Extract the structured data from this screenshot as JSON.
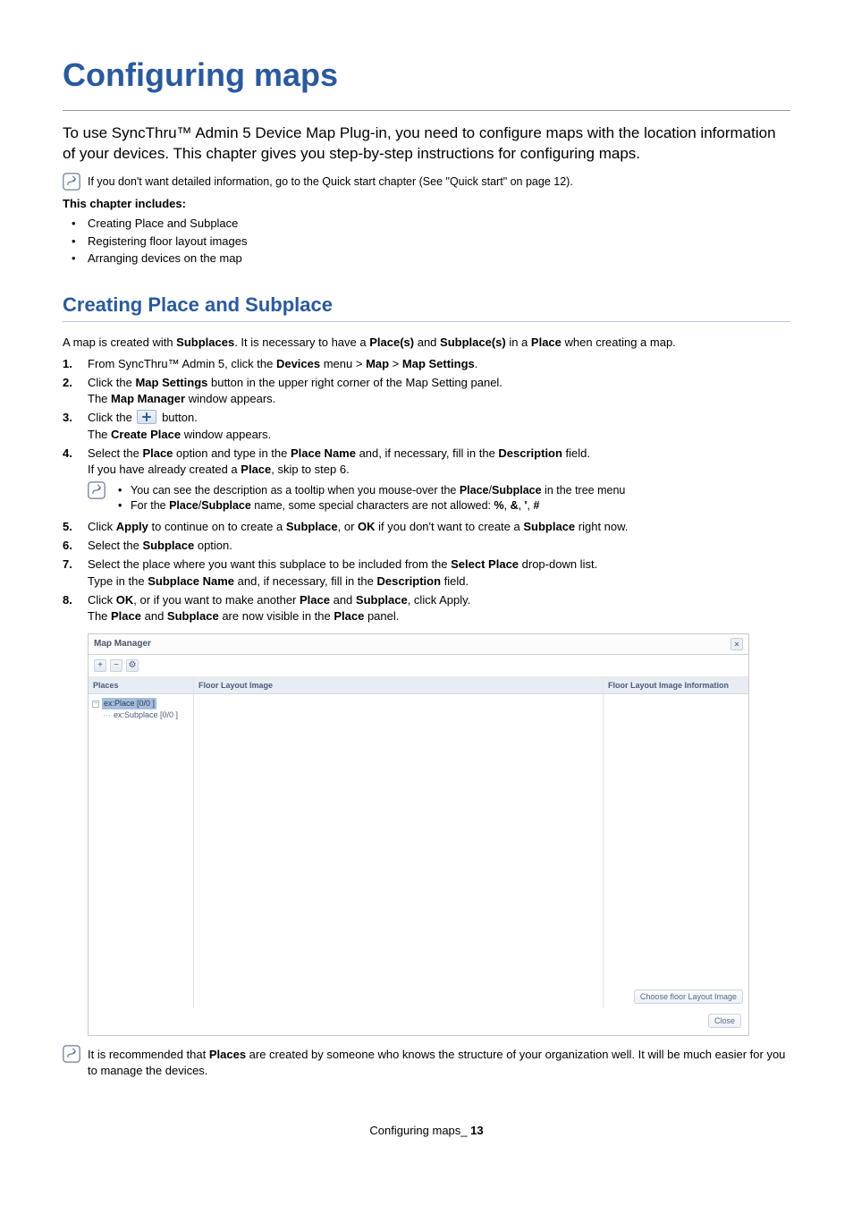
{
  "title": "Configuring maps",
  "intro": "To use SyncThru™ Admin 5 Device Map Plug-in, you need to configure maps with the location information of your devices. This chapter gives you step-by-step instructions for configuring maps.",
  "note_quickstart": "If you don't want detailed information, go to the Quick start chapter (See \"Quick start\" on page 12).",
  "includes_heading": "This chapter includes:",
  "includes": [
    "Creating Place and Subplace",
    "Registering floor layout images",
    "Arranging devices on the map"
  ],
  "section_heading": "Creating Place and Subplace",
  "section_intro_pre": "A map is created with ",
  "section_intro_b1": "Subplaces",
  "section_intro_mid1": ". It is necessary to have a ",
  "section_intro_b2": "Place(s)",
  "section_intro_mid2": " and ",
  "section_intro_b3": "Subplace(s)",
  "section_intro_mid3": " in a ",
  "section_intro_b4": "Place",
  "section_intro_post": " when creating a map.",
  "steps": {
    "s1_a": "From SyncThru™ Admin 5, click the ",
    "s1_b1": "Devices",
    "s1_b": " menu > ",
    "s1_b2": "Map",
    "s1_c": " > ",
    "s1_b3": "Map Settings",
    "s1_d": ".",
    "s2_a": "Click the ",
    "s2_b1": "Map Settings",
    "s2_b": " button in the upper right corner of the Map Setting panel.",
    "s2_sub_a": "The ",
    "s2_sub_b1": "Map Manager",
    "s2_sub_b": " window appears.",
    "s3_a": "Click the ",
    "s3_b": " button.",
    "s3_sub_a": "The ",
    "s3_sub_b1": "Create Place",
    "s3_sub_b": " window appears.",
    "s4_a": "Select the ",
    "s4_b1": "Place",
    "s4_b": " option and type in the ",
    "s4_b2": "Place Name",
    "s4_c": " and, if necessary, fill in the ",
    "s4_b3": "Description",
    "s4_d": " field.",
    "s4_sub_a": "If you have already created a ",
    "s4_sub_b1": "Place",
    "s4_sub_b": ", skip to step 6.",
    "s4_note1_a": "You can see the description as a tooltip when you mouse-over the ",
    "s4_note1_b1": "Place",
    "s4_note1_b": "/",
    "s4_note1_b2": "Subplace",
    "s4_note1_c": " in the tree menu",
    "s4_note2_a": "For the ",
    "s4_note2_b1": "Place",
    "s4_note2_b": "/",
    "s4_note2_b2": "Subplace",
    "s4_note2_c": " name, some special characters are not allowed: ",
    "s4_note2_b3": "%",
    "s4_note2_d": ", ",
    "s4_note2_b4": "&",
    "s4_note2_e": ", ",
    "s4_note2_b5": "'",
    "s4_note2_f": ", ",
    "s4_note2_b6": "#",
    "s5_a": "Click ",
    "s5_b1": "Apply",
    "s5_b": " to continue on to create a ",
    "s5_b2": "Subplace",
    "s5_c": ", or ",
    "s5_b3": "OK",
    "s5_d": " if you don't want to create a ",
    "s5_b4": "Subplace",
    "s5_e": " right now.",
    "s6_a": "Select the ",
    "s6_b1": "Subplace",
    "s6_b": " option.",
    "s7_a": "Select the place where you want this subplace to be included from the ",
    "s7_b1": "Select Place",
    "s7_b": " drop-down list.",
    "s7_sub_a": "Type in the ",
    "s7_sub_b1": "Subplace Name",
    "s7_sub_b": " and, if necessary, fill in the ",
    "s7_sub_b2": "Description",
    "s7_sub_c": " field.",
    "s8_a": "Click ",
    "s8_b1": "OK",
    "s8_b": ", or if you want to make another ",
    "s8_b2": "Place",
    "s8_c": " and ",
    "s8_b3": "Subplace",
    "s8_d": ", click Apply.",
    "s8_sub_a": "The ",
    "s8_sub_b1": "Place",
    "s8_sub_b": " and ",
    "s8_sub_b2": "Subplace",
    "s8_sub_c": " are now visible in the ",
    "s8_sub_b3": "Place",
    "s8_sub_d": " panel."
  },
  "map_manager": {
    "title": "Map Manager",
    "col_places": "Places",
    "col_center": "Floor Layout Image",
    "col_right": "Floor Layout Image Information",
    "tree_place": "ex:Place [0/0 ]",
    "tree_subplace": "ex:Subplace [0/0 ]",
    "btn_choose": "Choose floor Layout Image",
    "btn_close": "Close"
  },
  "note_bottom_a": "It is recommended that ",
  "note_bottom_b1": "Places",
  "note_bottom_b": " are created by someone who knows the structure of your organization well. It will be much easier for you to manage the devices.",
  "footer_label": "Configuring maps",
  "footer_sep": "_ ",
  "footer_page": "13"
}
